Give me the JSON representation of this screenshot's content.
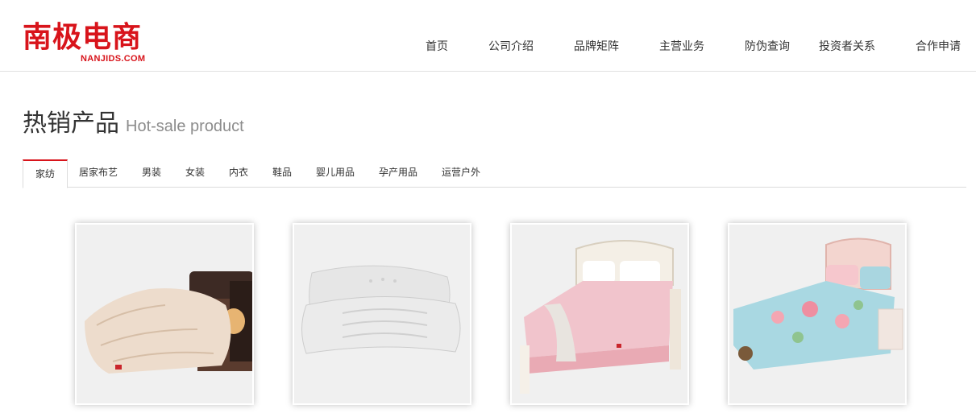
{
  "header": {
    "logo_cn": "南极电商",
    "logo_en": "NANJIDS.COM",
    "nav": [
      {
        "label": "首页"
      },
      {
        "label": "公司介绍"
      },
      {
        "label": "品牌矩阵"
      },
      {
        "label": "主营业务"
      },
      {
        "label": "防伪查询"
      },
      {
        "label": "投资者关系"
      },
      {
        "label": "合作申请"
      }
    ]
  },
  "section": {
    "title_cn": "热销产品",
    "title_en": "Hot-sale product"
  },
  "tabs": [
    {
      "label": "家纺",
      "active": true
    },
    {
      "label": "居家布艺"
    },
    {
      "label": "男装"
    },
    {
      "label": "女装"
    },
    {
      "label": "内衣"
    },
    {
      "label": "鞋品"
    },
    {
      "label": "婴儿用品"
    },
    {
      "label": "孕产用品"
    },
    {
      "label": "运营户外"
    }
  ],
  "products": [
    {
      "name": "comforter"
    },
    {
      "name": "pillows"
    },
    {
      "name": "pink-mattress-bed"
    },
    {
      "name": "floral-bedding-set"
    }
  ],
  "colors": {
    "brand_red": "#d8141b",
    "text": "#333333",
    "muted": "#8c8c8c",
    "divider": "#dcdcdc"
  }
}
